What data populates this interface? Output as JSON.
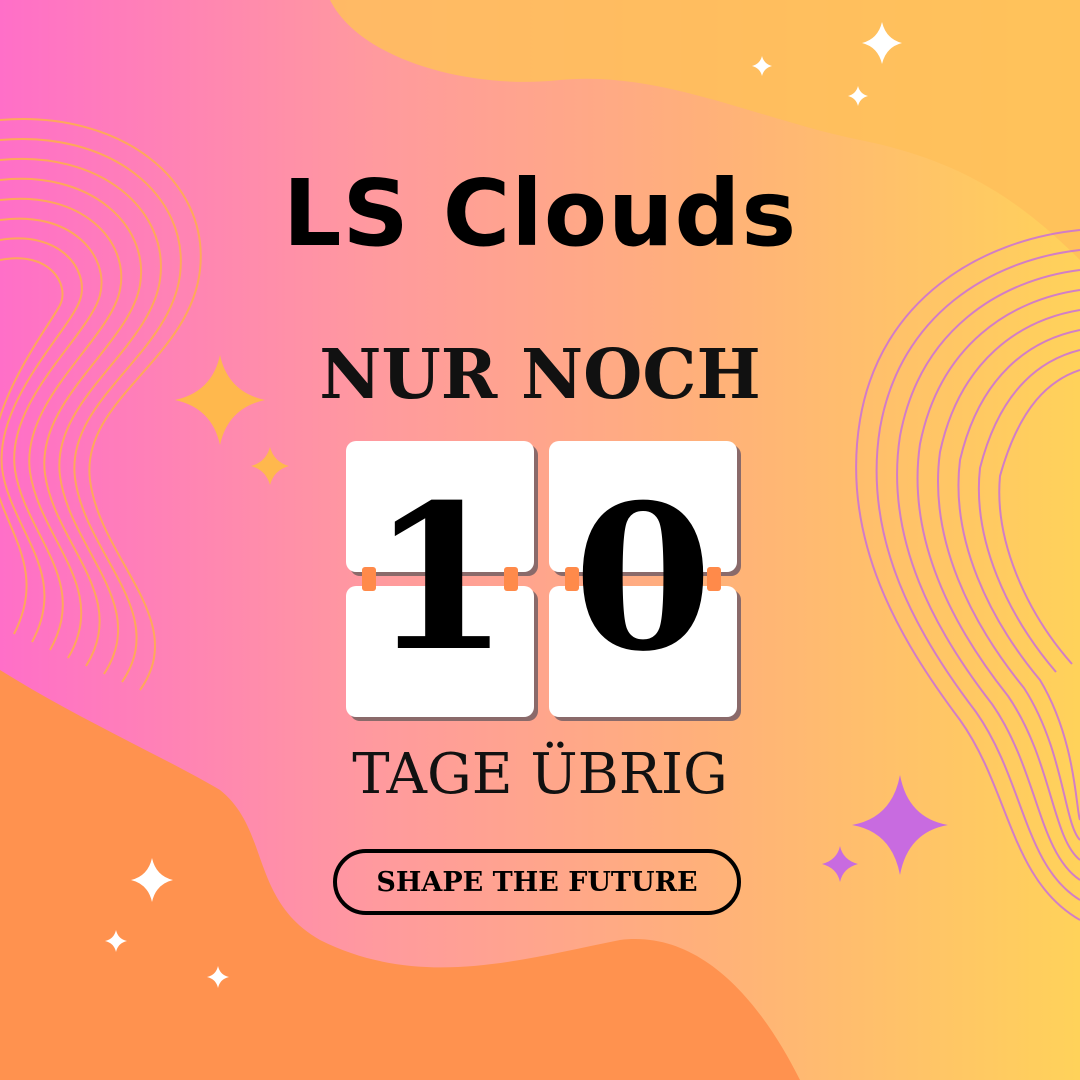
{
  "title": "LS Clouds",
  "subtitle": "NUR NOCH",
  "countdown": {
    "digits": [
      "1",
      "0"
    ]
  },
  "caption": "TAGE ÜBRIG",
  "cta_label": "SHAPE THE FUTURE",
  "colors": {
    "pink": "#ff6fc8",
    "peach": "#ffb07a",
    "yellow": "#ffd25a",
    "orange_blob": "#ff924f",
    "sparkle_gold": "#ffb84d",
    "sparkle_purple": "#c86be0",
    "pin": "#ff8a4a"
  }
}
